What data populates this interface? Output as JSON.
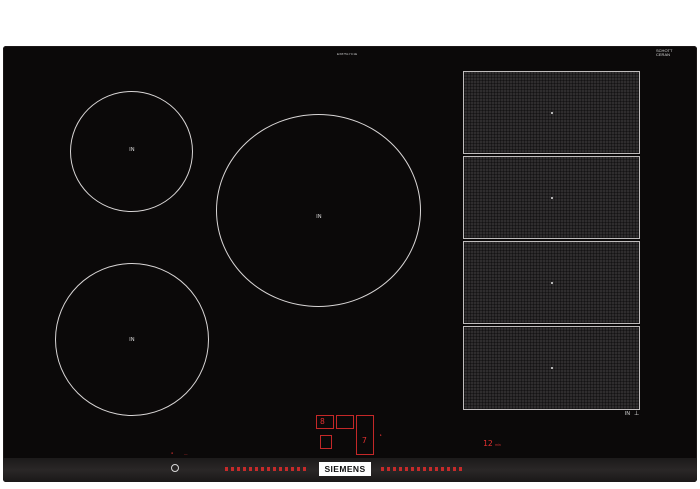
{
  "hob": {
    "model_number": "EX875LYC1E",
    "schott_ceran": "SCHOTT\nCERAN",
    "zone_label": "IN",
    "flex_label": "IN",
    "timer_display": "12",
    "timer_unit": "min",
    "brand": "SIEMENS",
    "level_display": "8",
    "level_alt": "7"
  },
  "colors": {
    "glass": "#0b0909",
    "ring": "#d9d6d6",
    "touch_red": "#e23030",
    "flex_grey": "#2f2d2e"
  },
  "icons": [
    "power-icon",
    "flex-zone-icon"
  ]
}
